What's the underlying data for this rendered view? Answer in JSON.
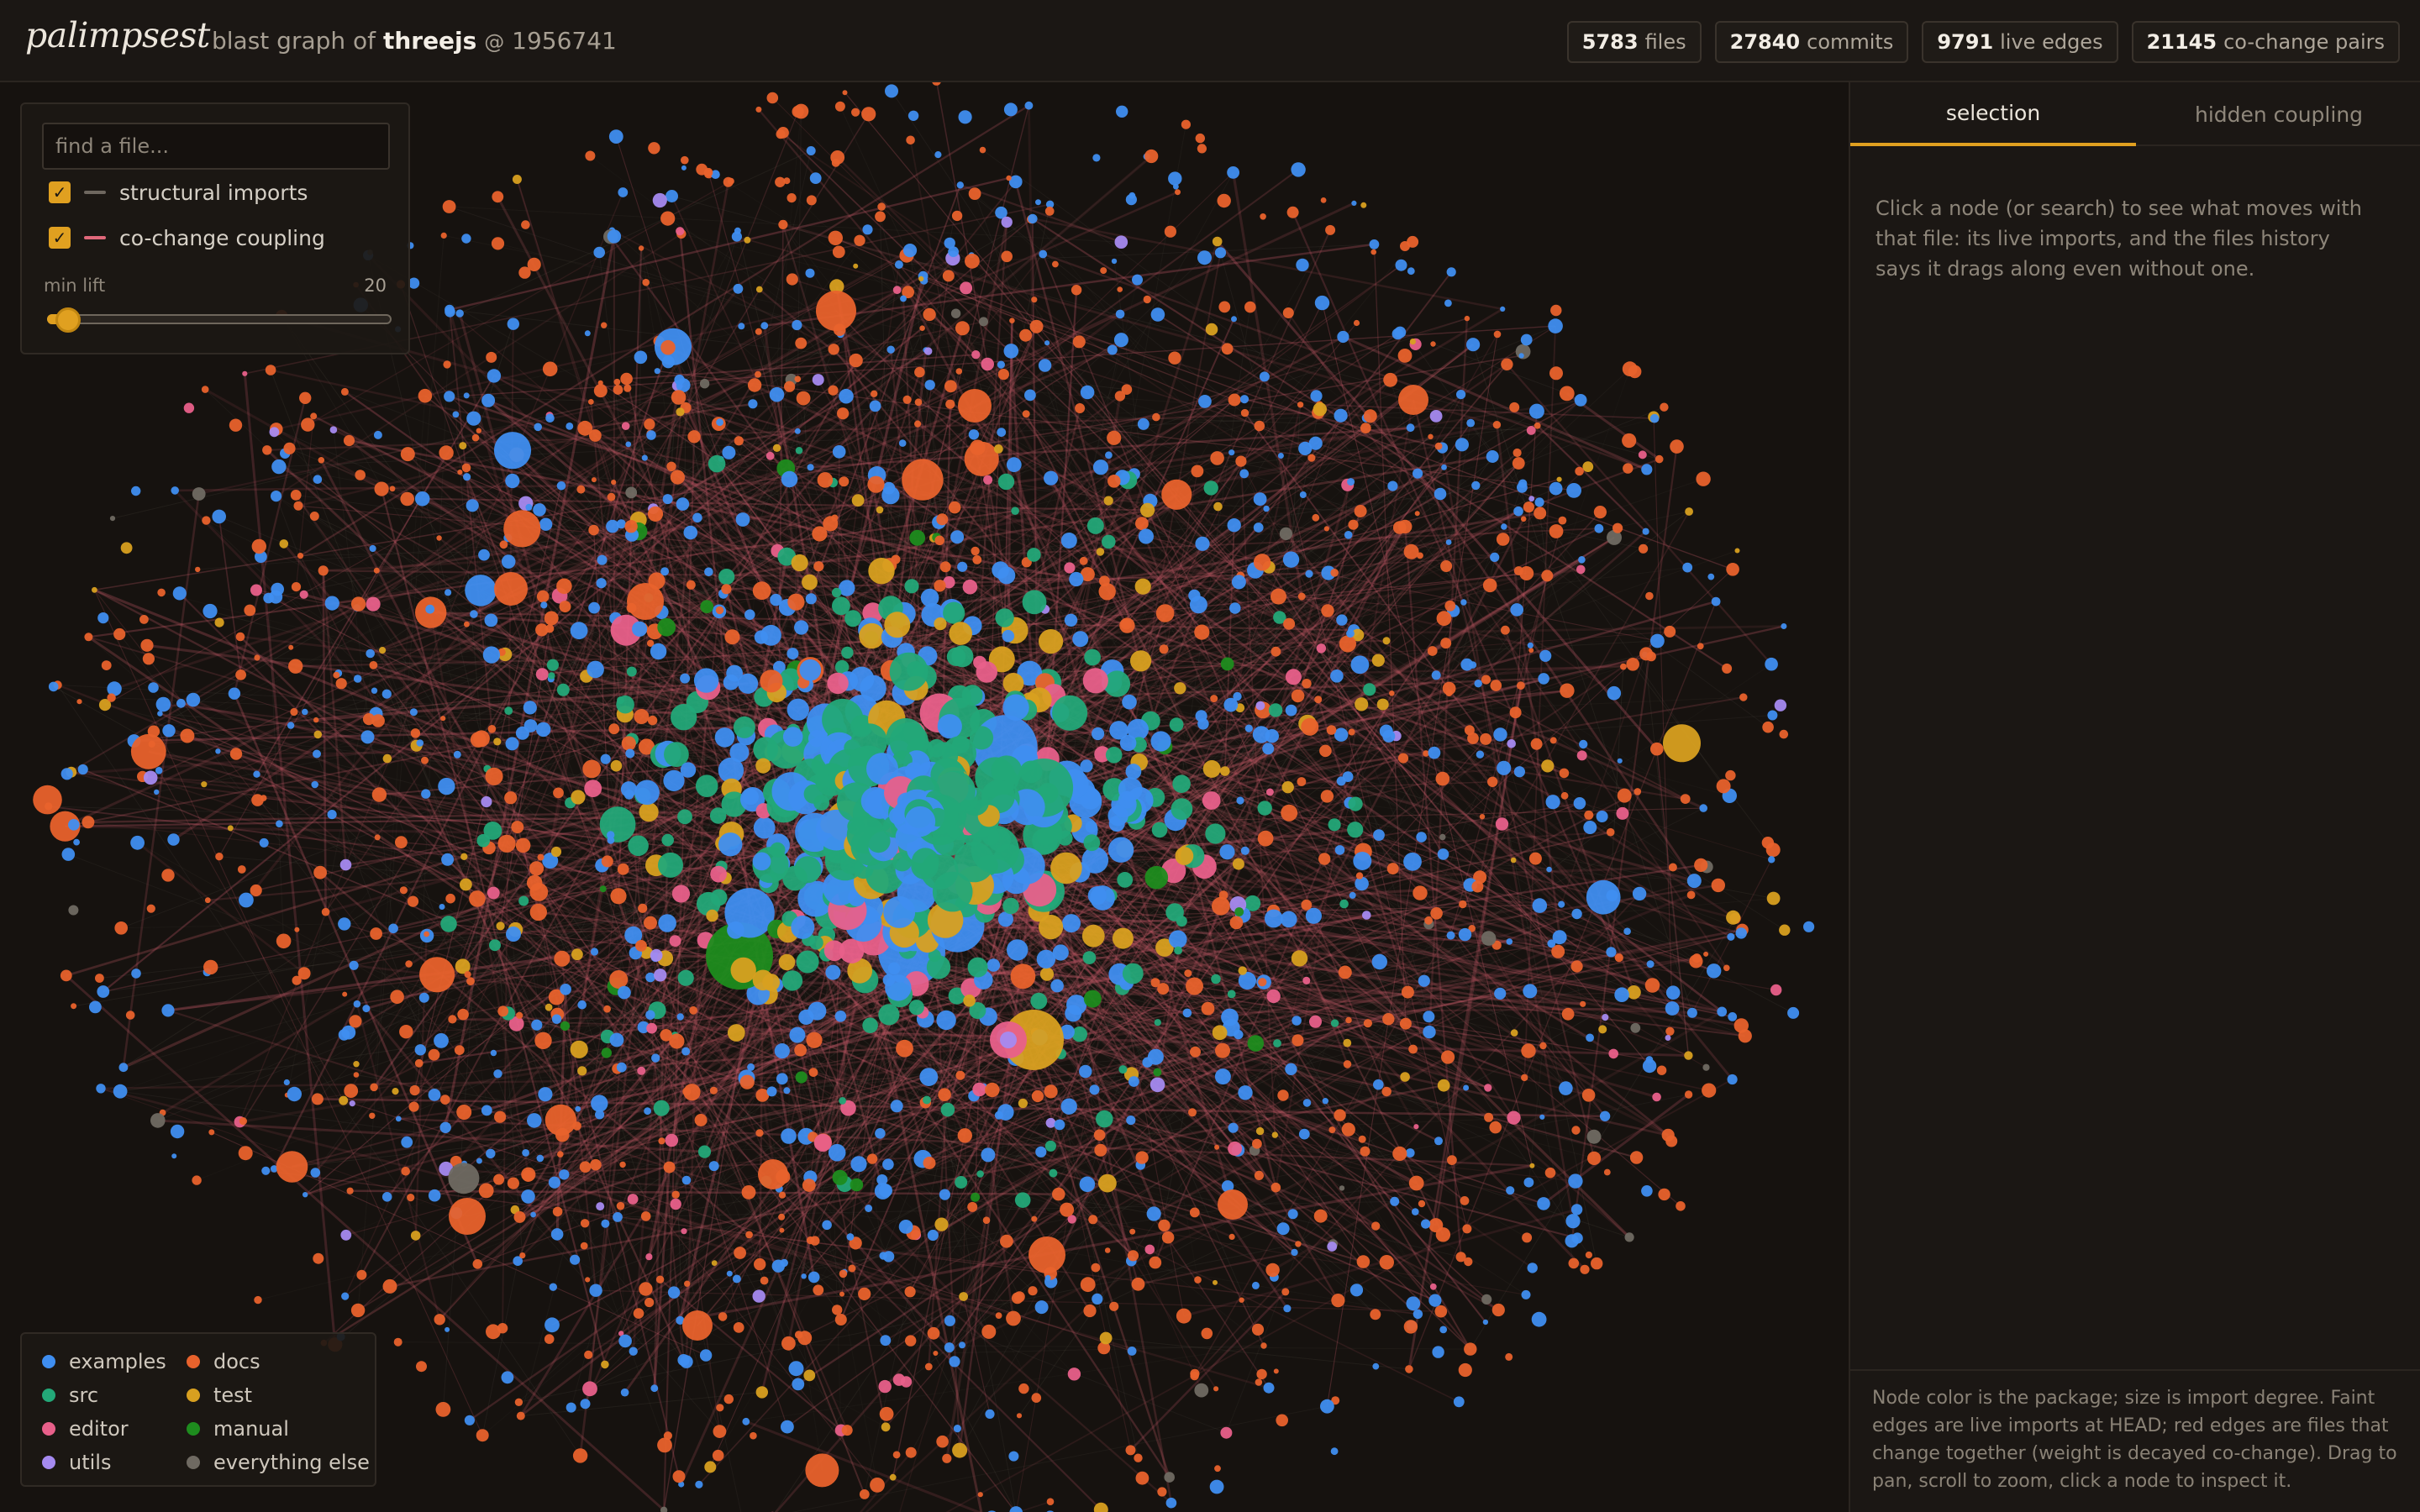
{
  "header": {
    "brand": "palimpsest",
    "subtitle_prefix": "blast graph of",
    "repo": "threejs",
    "at": "@",
    "commit": "1956741",
    "stats": [
      {
        "num": "5783",
        "label": "files"
      },
      {
        "num": "27840",
        "label": "commits"
      },
      {
        "num": "9791",
        "label": "live edges"
      },
      {
        "num": "21145",
        "label": "co-change pairs"
      }
    ]
  },
  "controls": {
    "search_placeholder": "find a file...",
    "toggles": [
      {
        "label": "structural imports",
        "checked": true,
        "color": "#6e675f"
      },
      {
        "label": "co-change coupling",
        "checked": true,
        "color": "#e0687a"
      }
    ],
    "min_lift_label": "min lift",
    "min_lift_value": "20",
    "min_lift_fraction": 0.06
  },
  "legend": [
    {
      "label": "examples",
      "color": "#3f8ef0"
    },
    {
      "label": "docs",
      "color": "#e8622c"
    },
    {
      "label": "src",
      "color": "#23a878"
    },
    {
      "label": "test",
      "color": "#d8a020"
    },
    {
      "label": "editor",
      "color": "#e8608a"
    },
    {
      "label": "manual",
      "color": "#1e8c1e"
    },
    {
      "label": "utils",
      "color": "#a58af0"
    },
    {
      "label": "everything else",
      "color": "#6f6a62"
    }
  ],
  "colors": {
    "accent": "#e0a020",
    "background": "#171310",
    "panel": "#1b1714"
  },
  "panel": {
    "tabs": [
      "selection",
      "hidden coupling"
    ],
    "active_tab": "selection",
    "hint": "Click a node (or search) to see what moves with that file: its live imports, and the files history says it drags along even without one.",
    "footer": "Node color is the package; size is import degree. Faint edges are live imports at HEAD; red edges are files that change together (weight is decayed co-change). Drag to pan, scroll to zoom, click a node to inspect it."
  }
}
